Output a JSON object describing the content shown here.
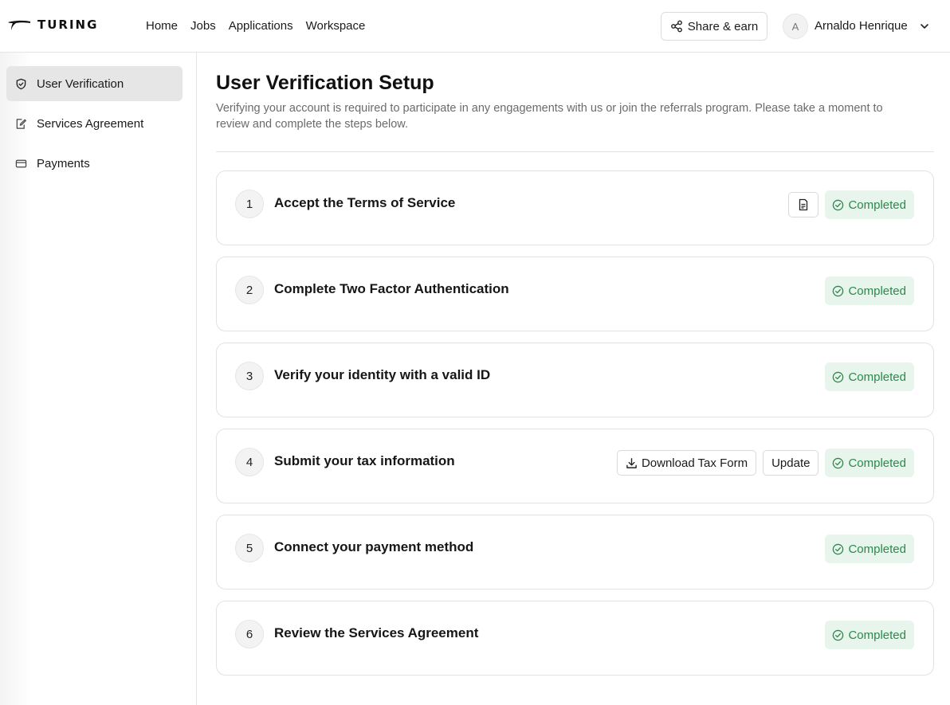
{
  "header": {
    "logo_text": "TURING",
    "nav": [
      "Home",
      "Jobs",
      "Applications",
      "Workspace"
    ],
    "share_label": "Share & earn",
    "avatar_initial": "A",
    "user_name": "Arnaldo Henrique"
  },
  "sidebar": {
    "items": [
      {
        "label": "User Verification",
        "icon": "shield-check-icon",
        "active": true
      },
      {
        "label": "Services Agreement",
        "icon": "edit-document-icon",
        "active": false
      },
      {
        "label": "Payments",
        "icon": "credit-card-icon",
        "active": false
      }
    ]
  },
  "main": {
    "title": "User Verification Setup",
    "description": "Verifying your account is required to participate in any engagements with us or join the referrals program. Please take a moment to review and complete the steps below.",
    "steps": [
      {
        "number": "1",
        "title": "Accept the Terms of Service",
        "status": "Completed"
      },
      {
        "number": "2",
        "title": "Complete Two Factor Authentication",
        "status": "Completed"
      },
      {
        "number": "3",
        "title": "Verify your identity with a valid ID",
        "status": "Completed"
      },
      {
        "number": "4",
        "title": "Submit your tax information",
        "status": "Completed",
        "download_label": "Download Tax Form",
        "update_label": "Update"
      },
      {
        "number": "5",
        "title": "Connect your payment method",
        "status": "Completed"
      },
      {
        "number": "6",
        "title": "Review the Services Agreement",
        "status": "Completed"
      }
    ]
  },
  "colors": {
    "completed_bg": "#e8f5ec",
    "completed_text": "#2a8a4a",
    "active_sidebar_bg": "#e6e6e6"
  }
}
